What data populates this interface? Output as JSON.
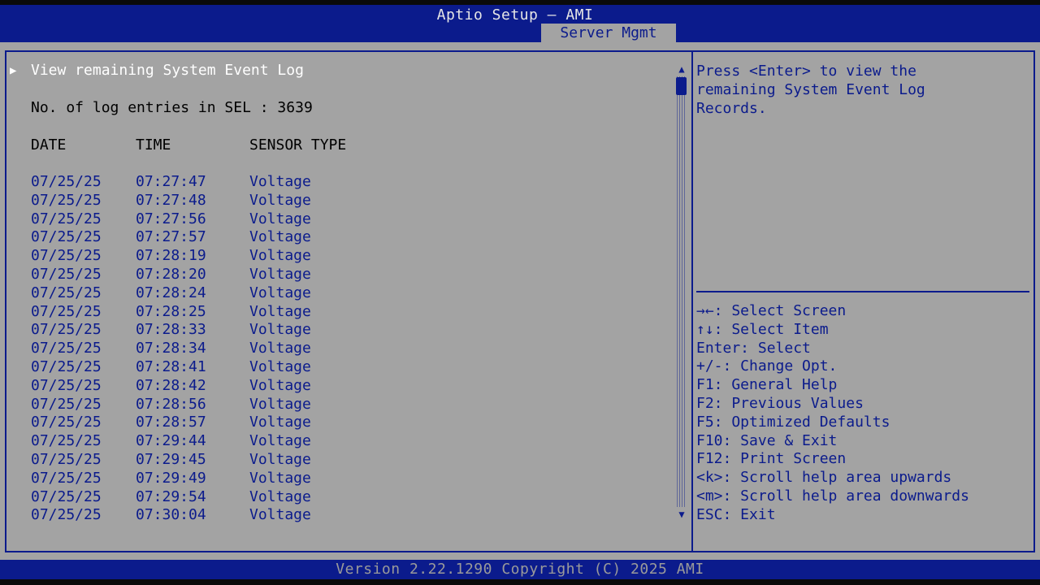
{
  "window": {
    "title": "Aptio Setup – AMI"
  },
  "tabs": [
    {
      "label": "Server Mgmt",
      "active": true
    }
  ],
  "main": {
    "submenu_label": "View remaining System Event Log",
    "log_count_label": "No. of log entries in SEL : 3639",
    "columns": {
      "date": "DATE",
      "time": "TIME",
      "sensor_type": "SENSOR TYPE"
    },
    "rows": [
      {
        "date": "07/25/25",
        "time": "07:27:47",
        "sensor_type": "Voltage"
      },
      {
        "date": "07/25/25",
        "time": "07:27:48",
        "sensor_type": "Voltage"
      },
      {
        "date": "07/25/25",
        "time": "07:27:56",
        "sensor_type": "Voltage"
      },
      {
        "date": "07/25/25",
        "time": "07:27:57",
        "sensor_type": "Voltage"
      },
      {
        "date": "07/25/25",
        "time": "07:28:19",
        "sensor_type": "Voltage"
      },
      {
        "date": "07/25/25",
        "time": "07:28:20",
        "sensor_type": "Voltage"
      },
      {
        "date": "07/25/25",
        "time": "07:28:24",
        "sensor_type": "Voltage"
      },
      {
        "date": "07/25/25",
        "time": "07:28:25",
        "sensor_type": "Voltage"
      },
      {
        "date": "07/25/25",
        "time": "07:28:33",
        "sensor_type": "Voltage"
      },
      {
        "date": "07/25/25",
        "time": "07:28:34",
        "sensor_type": "Voltage"
      },
      {
        "date": "07/25/25",
        "time": "07:28:41",
        "sensor_type": "Voltage"
      },
      {
        "date": "07/25/25",
        "time": "07:28:42",
        "sensor_type": "Voltage"
      },
      {
        "date": "07/25/25",
        "time": "07:28:56",
        "sensor_type": "Voltage"
      },
      {
        "date": "07/25/25",
        "time": "07:28:57",
        "sensor_type": "Voltage"
      },
      {
        "date": "07/25/25",
        "time": "07:29:44",
        "sensor_type": "Voltage"
      },
      {
        "date": "07/25/25",
        "time": "07:29:45",
        "sensor_type": "Voltage"
      },
      {
        "date": "07/25/25",
        "time": "07:29:49",
        "sensor_type": "Voltage"
      },
      {
        "date": "07/25/25",
        "time": "07:29:54",
        "sensor_type": "Voltage"
      },
      {
        "date": "07/25/25",
        "time": "07:30:04",
        "sensor_type": "Voltage"
      }
    ]
  },
  "help": {
    "text": "Press <Enter> to view the\nremaining System Event Log\nRecords.",
    "keys": [
      "→←: Select Screen",
      "↑↓: Select Item",
      "Enter: Select",
      "+/-: Change Opt.",
      "F1: General Help",
      "F2: Previous Values",
      "F5: Optimized Defaults",
      "F10: Save & Exit",
      "F12: Print Screen",
      "<k>: Scroll help area upwards",
      "<m>: Scroll help area downwards",
      "ESC: Exit"
    ]
  },
  "footer": {
    "version": "Version 2.22.1290 Copyright (C) 2025 AMI"
  },
  "icons": {
    "selection": "triangle-right-icon",
    "scroll_up": "triangle-up-icon",
    "scroll_down": "triangle-down-icon"
  },
  "colors": {
    "header_blue": "#0b1b8c",
    "panel_gray": "#a3a3a3",
    "highlight": "#ffffff"
  }
}
